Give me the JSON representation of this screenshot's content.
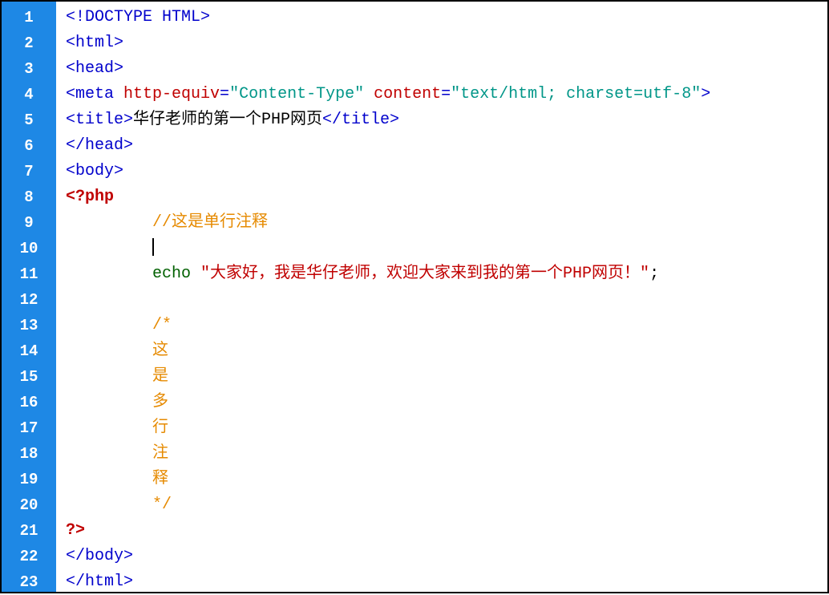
{
  "lines": [
    {
      "n": "1",
      "segs": [
        {
          "c": "tag",
          "t": "<!DOCTYPE HTML>"
        }
      ]
    },
    {
      "n": "2",
      "segs": [
        {
          "c": "tag",
          "t": "<html>"
        }
      ]
    },
    {
      "n": "3",
      "segs": [
        {
          "c": "tag",
          "t": "<head>"
        }
      ]
    },
    {
      "n": "4",
      "segs": [
        {
          "c": "tag",
          "t": "<meta "
        },
        {
          "c": "attr",
          "t": "http-equiv"
        },
        {
          "c": "tag",
          "t": "="
        },
        {
          "c": "str",
          "t": "\"Content-Type\""
        },
        {
          "c": "tag",
          "t": " "
        },
        {
          "c": "attr",
          "t": "content"
        },
        {
          "c": "tag",
          "t": "="
        },
        {
          "c": "str",
          "t": "\"text/html; charset=utf-8\""
        },
        {
          "c": "tag",
          "t": ">"
        }
      ]
    },
    {
      "n": "5",
      "segs": [
        {
          "c": "tag",
          "t": "<title>"
        },
        {
          "c": "plain",
          "t": "华仔老师的第一个PHP网页"
        },
        {
          "c": "tag",
          "t": "</title>"
        }
      ]
    },
    {
      "n": "6",
      "segs": [
        {
          "c": "tag",
          "t": "</head>"
        }
      ]
    },
    {
      "n": "7",
      "segs": [
        {
          "c": "tag",
          "t": "<body>"
        }
      ]
    },
    {
      "n": "8",
      "segs": [
        {
          "c": "php",
          "t": "<?php"
        }
      ]
    },
    {
      "n": "9",
      "segs": [
        {
          "c": "plain",
          "t": "         "
        },
        {
          "c": "cmt",
          "t": "//这是单行注释"
        }
      ]
    },
    {
      "n": "10",
      "segs": [
        {
          "c": "plain",
          "t": "         "
        },
        {
          "c": "cursor",
          "t": ""
        }
      ]
    },
    {
      "n": "11",
      "segs": [
        {
          "c": "plain",
          "t": "         "
        },
        {
          "c": "kw",
          "t": "echo "
        },
        {
          "c": "txt",
          "t": "\"大家好，我是华仔老师，欢迎大家来到我的第一个PHP网页！\""
        },
        {
          "c": "plain",
          "t": ";"
        }
      ]
    },
    {
      "n": "12",
      "segs": []
    },
    {
      "n": "13",
      "segs": [
        {
          "c": "plain",
          "t": "         "
        },
        {
          "c": "cmt",
          "t": "/*"
        }
      ]
    },
    {
      "n": "14",
      "segs": [
        {
          "c": "plain",
          "t": "         "
        },
        {
          "c": "cmt",
          "t": "这"
        }
      ]
    },
    {
      "n": "15",
      "segs": [
        {
          "c": "plain",
          "t": "         "
        },
        {
          "c": "cmt",
          "t": "是"
        }
      ]
    },
    {
      "n": "16",
      "segs": [
        {
          "c": "plain",
          "t": "         "
        },
        {
          "c": "cmt",
          "t": "多"
        }
      ]
    },
    {
      "n": "17",
      "segs": [
        {
          "c": "plain",
          "t": "         "
        },
        {
          "c": "cmt",
          "t": "行"
        }
      ]
    },
    {
      "n": "18",
      "segs": [
        {
          "c": "plain",
          "t": "         "
        },
        {
          "c": "cmt",
          "t": "注"
        }
      ]
    },
    {
      "n": "19",
      "segs": [
        {
          "c": "plain",
          "t": "         "
        },
        {
          "c": "cmt",
          "t": "释"
        }
      ]
    },
    {
      "n": "20",
      "segs": [
        {
          "c": "plain",
          "t": "         "
        },
        {
          "c": "cmt",
          "t": "*/"
        }
      ]
    },
    {
      "n": "21",
      "segs": [
        {
          "c": "php",
          "t": "?>"
        }
      ]
    },
    {
      "n": "22",
      "segs": [
        {
          "c": "tag",
          "t": "</body>"
        }
      ]
    },
    {
      "n": "23",
      "segs": [
        {
          "c": "tag",
          "t": "</html>"
        }
      ]
    }
  ]
}
